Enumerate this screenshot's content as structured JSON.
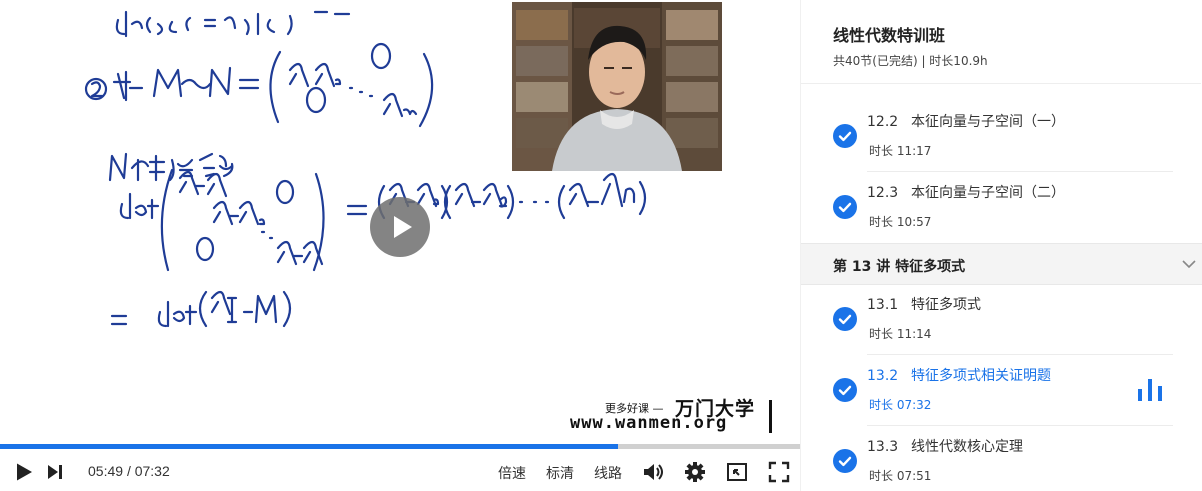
{
  "player": {
    "current_time": "05:49",
    "separator": "/",
    "duration": "07:32",
    "progress": 0.772,
    "controls": {
      "speed_label": "倍速",
      "quality_label": "标清",
      "route_label": "线路"
    },
    "watermark": {
      "tagline": "更多好课 —",
      "brand": "万门大学",
      "url": "www.wanmen.org"
    },
    "accent": "#1a73e8"
  },
  "course": {
    "title": "线性代数特训班",
    "meta": "共40节(已完结) | 时长10.9h"
  },
  "lessons_before": [
    {
      "num": "12.2",
      "title": "本征向量与子空间（一）",
      "duration": "时长 11:17",
      "done": true
    },
    {
      "num": "12.3",
      "title": "本征向量与子空间（二）",
      "duration": "时长 10:57",
      "done": true
    }
  ],
  "chapter": {
    "label": "第 13 讲   特征多项式",
    "icon": "chevron-down-icon"
  },
  "lessons_after": [
    {
      "num": "13.1",
      "title": "特征多项式",
      "duration": "时长 11:14",
      "done": true,
      "active": false
    },
    {
      "num": "13.2",
      "title": "特征多项式相关证明题",
      "duration": "时长 07:32",
      "done": true,
      "active": true
    },
    {
      "num": "13.3",
      "title": "线性代数核心定理",
      "duration": "时长 07:51",
      "done": true,
      "active": false
    }
  ]
}
